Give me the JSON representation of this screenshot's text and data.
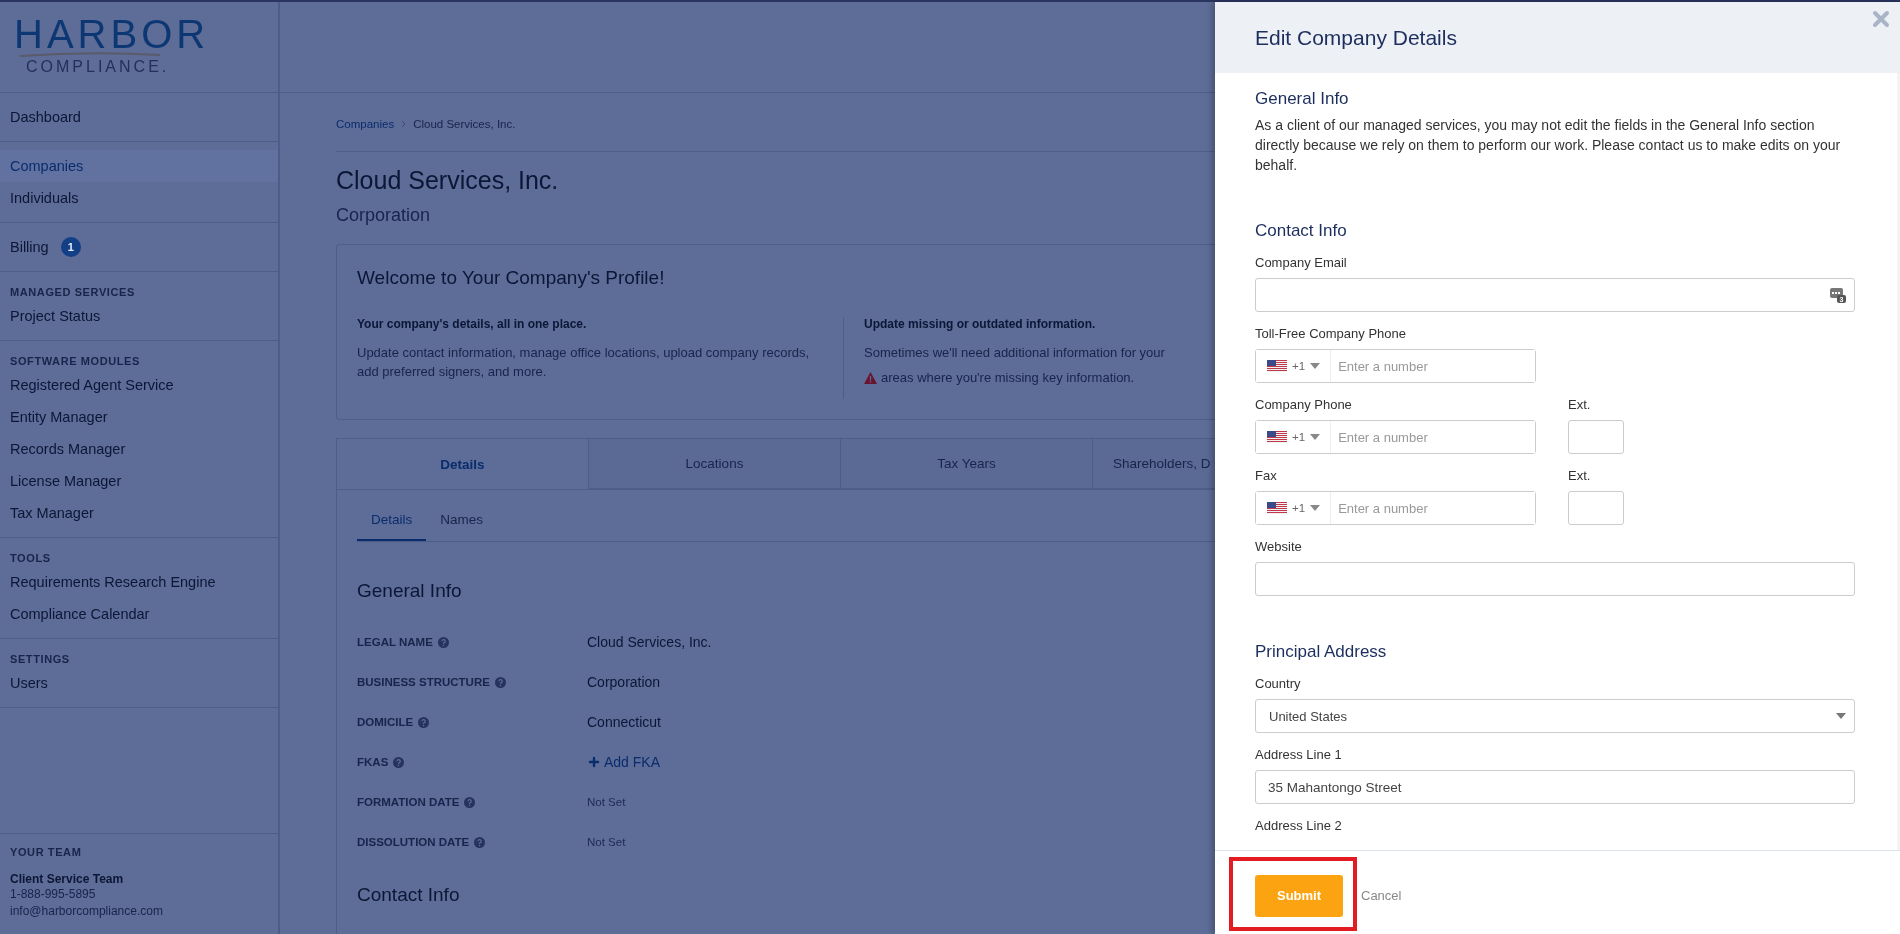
{
  "sidebar": {
    "logo": {
      "line_1": "HARBOR",
      "line_2": "COMPLIANCE."
    },
    "groups": [
      {
        "items": [
          {
            "label": "Dashboard",
            "selected": false
          }
        ]
      },
      {
        "items": [
          {
            "label": "Companies",
            "selected": true
          },
          {
            "label": "Individuals",
            "selected": false
          }
        ]
      },
      {
        "items": [
          {
            "label": "Billing",
            "selected": false,
            "badge": "1"
          }
        ]
      },
      {
        "heading": "MANAGED SERVICES",
        "items": [
          {
            "label": "Project Status",
            "selected": false
          }
        ]
      },
      {
        "heading": "SOFTWARE MODULES",
        "items": [
          {
            "label": "Registered Agent Service",
            "selected": false
          },
          {
            "label": "Entity Manager",
            "selected": false
          },
          {
            "label": "Records Manager",
            "selected": false
          },
          {
            "label": "License Manager",
            "selected": false
          },
          {
            "label": "Tax Manager",
            "selected": false
          }
        ]
      },
      {
        "heading": "TOOLS",
        "items": [
          {
            "label": "Requirements Research Engine",
            "selected": false
          },
          {
            "label": "Compliance Calendar",
            "selected": false
          }
        ]
      },
      {
        "heading": "SETTINGS",
        "items": [
          {
            "label": "Users",
            "selected": false
          }
        ]
      }
    ],
    "team": {
      "heading": "YOUR TEAM",
      "name": "Client Service Team",
      "phone": "1-888-995-5895",
      "email": "info@harborcompliance.com"
    }
  },
  "breadcrumb": [
    {
      "label": "Companies",
      "kind": "link"
    },
    {
      "label": "Cloud Services, Inc.",
      "kind": "current"
    }
  ],
  "company": {
    "name": "Cloud Services, Inc.",
    "type": "Corporation"
  },
  "welcome": {
    "title": "Welcome to Your Company's Profile!",
    "columns": [
      {
        "heading": "Your company's details, all in one place.",
        "paragraphs": [
          {
            "text": "Update contact information, manage office locations, upload company records, add preferred signers, and more.",
            "warning": false
          }
        ]
      },
      {
        "heading": "Update missing or outdated information.",
        "paragraphs": [
          {
            "text": "Sometimes we'll need additional information for your",
            "warning": false
          },
          {
            "text": "areas where you're missing key information.",
            "warning": true
          }
        ]
      }
    ]
  },
  "tabs": [
    {
      "label": "Details",
      "selected": true
    },
    {
      "label": "Locations",
      "selected": false
    },
    {
      "label": "Tax Years",
      "selected": false
    },
    {
      "label": "Shareholders, D",
      "selected": false
    }
  ],
  "subtabs": [
    {
      "label": "Details",
      "selected": true
    },
    {
      "label": "Names",
      "selected": false
    }
  ],
  "general_info": {
    "heading": "General Info",
    "rows": [
      {
        "label": "LEGAL NAME",
        "value": "Cloud Services, Inc.",
        "kind": "text"
      },
      {
        "label": "BUSINESS STRUCTURE",
        "value": "Corporation",
        "kind": "text"
      },
      {
        "label": "DOMICILE",
        "value": "Connecticut",
        "kind": "text"
      },
      {
        "label": "FKAS",
        "value": "Add FKA",
        "kind": "link"
      },
      {
        "label": "FORMATION DATE",
        "value": "Not Set",
        "kind": "empty"
      },
      {
        "label": "DISSOLUTION DATE",
        "value": "Not Set",
        "kind": "empty"
      }
    ]
  },
  "next_section_heading": "Contact Info",
  "drawer": {
    "title": "Edit Company Details",
    "sections": [
      {
        "heading": "General Info",
        "note": "As a client of our managed services, you may not edit the fields in the General Info section directly because we rely on them to perform our work. Please contact us to make edits on your behalf."
      },
      {
        "heading": "Contact Info",
        "fields": [
          {
            "kind": "email",
            "label": "Company Email",
            "autofill_count": "3"
          },
          {
            "kind": "phone",
            "label": "Toll-Free Company Phone",
            "dial_code": "+1",
            "placeholder": "Enter a number"
          },
          {
            "kind": "phone",
            "label": "Company Phone",
            "dial_code": "+1",
            "placeholder": "Enter a number",
            "ext_label": "Ext."
          },
          {
            "kind": "phone",
            "label": "Fax",
            "dial_code": "+1",
            "placeholder": "Enter a number",
            "ext_label": "Ext."
          },
          {
            "kind": "text",
            "label": "Website"
          }
        ]
      },
      {
        "heading": "Principal Address",
        "fields": [
          {
            "kind": "select",
            "label": "Country",
            "value": "United States"
          },
          {
            "kind": "text",
            "label": "Address Line 1",
            "value": "35 Mahantongo Street"
          },
          {
            "kind": "cut",
            "label": "Address Line 2"
          }
        ]
      }
    ],
    "footer": {
      "submit": "Submit",
      "cancel": "Cancel",
      "highlighted": true
    }
  }
}
